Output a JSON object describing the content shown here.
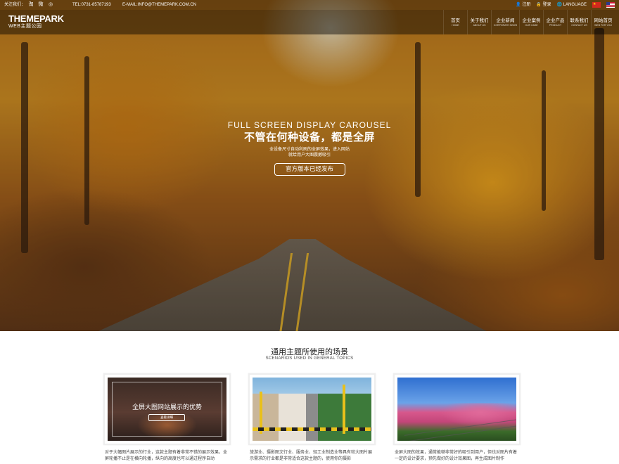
{
  "topbar": {
    "follow_label": "关注我们：",
    "social_icons": [
      "taobao-icon",
      "weibo-icon",
      "wechat-icon"
    ],
    "social_glyphs": [
      "淘",
      "微",
      "◎"
    ],
    "tel": "TEL:0731-85787193",
    "email": "E-MAIL:INFO@THEMEPARK.COM.CN",
    "register": "注册",
    "login": "登录",
    "language": "LANGUAGE"
  },
  "header": {
    "logo_brand": "THEMEPARK",
    "logo_sub": "WEB主题公园",
    "nav": [
      {
        "cn": "首页",
        "en": "HOME"
      },
      {
        "cn": "关于我们",
        "en": "ABOUT US"
      },
      {
        "cn": "企业新闻",
        "en": "CORPORATE NEWS"
      },
      {
        "cn": "企业案例",
        "en": "OUR CASE"
      },
      {
        "cn": "企业产品",
        "en": "PRODUCT"
      },
      {
        "cn": "联系我们",
        "en": "CONTACT US"
      },
      {
        "cn": "网站首页",
        "en": "WEB FOR YOU"
      }
    ]
  },
  "hero": {
    "title_en": "FULL SCREEN DISPLAY CAROUSEL",
    "title_cn": "不管在何种设备，都是全屏",
    "desc_line1": "全设备尺寸自动利刷的全屏效果，进入网站",
    "desc_line2": "就给用户大图震撼吸引",
    "button": "官方版本已经发布"
  },
  "section": {
    "title": "通用主题所使用的场景",
    "subtitle": "SCENARIOS USED IN GENERAL TOPICS"
  },
  "cards": [
    {
      "overlay_title": "全屏大图网站展示的优势",
      "overlay_button": "查看详细",
      "text": "对于大幅图片展示的行业，这款主题有着非常不错的展示效果，全屏轮播不止是在横向轮播，纵向的高度也可以通过程序自动"
    },
    {
      "text": "旅游业、摄影图文行业、服务业、轻工业制造业等具有较大图片展示需求的行业都是非常适合这款主题的，使用你的摄影"
    },
    {
      "text": "全屏大图的效果，通常能够非常好的吸引到用户，但也对图片有着一定的设计要求，预先做好的设计效果图，再生成图片制作"
    }
  ],
  "colors": {
    "hero_accent": "#c88a22",
    "header_overlay": "#000000",
    "text_dark": "#222222"
  }
}
